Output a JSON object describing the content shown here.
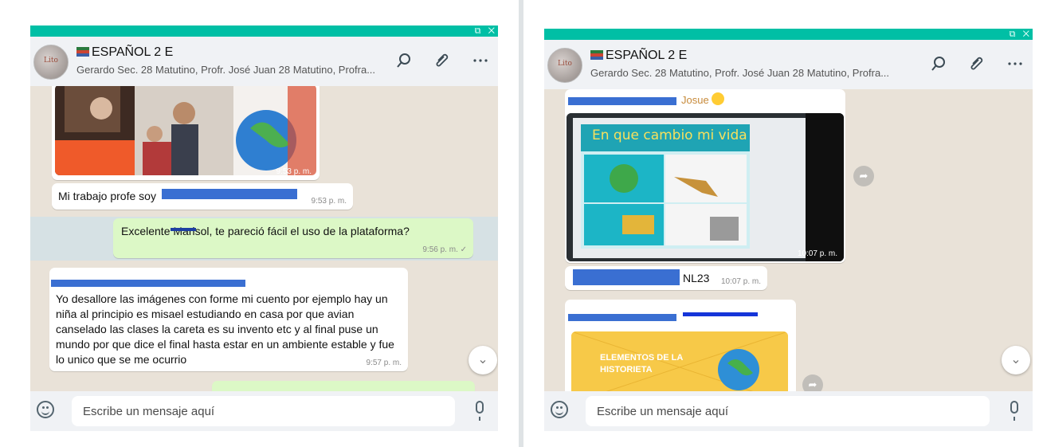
{
  "left": {
    "header": {
      "title": "ESPAÑOL 2 E",
      "subtitle": "Gerardo Sec. 28 Matutino, Profr. José Juan 28 Matutino, Profra..."
    },
    "image_message": {
      "time": "9:53 p. m."
    },
    "messages": [
      {
        "text": "Mi trabajo profe soy",
        "time": "9:53 p. m."
      },
      {
        "text": "Excelente Marisol, te pareció fácil el uso de la plataforma?",
        "time": "9:56 p. m. ✓"
      },
      {
        "text": "Yo desallore las imágenes con forme mi cuento por ejemplo hay un niña al principio  es misael estudiando en casa por que avian canselado las clases la careta es su invento etc y al final puse un mundo por que dice el final hasta estar en un ambiente estable y fue lo unico que se me ocurrio",
        "time": "9:57 p. m."
      }
    ],
    "compose_placeholder": "Escribe un mensaje aquí",
    "icons": [
      "search-icon",
      "attach-icon",
      "menu-icon",
      "emoji-icon",
      "mic-icon",
      "scroll-down-icon"
    ]
  },
  "right": {
    "header": {
      "title": "ESPAÑOL 2 E",
      "subtitle": "Gerardo Sec. 28 Matutino, Profr. José Juan 28 Matutino, Profra..."
    },
    "sender_name": "Josue",
    "image_message": {
      "poster_title": "En que cambio mi vida",
      "time": "10:07 p. m."
    },
    "caption": {
      "text": "NL23",
      "time": "10:07 p. m."
    },
    "card_text": {
      "line1": "ELEMENTOS DE LA",
      "line2": "HISTORIETA"
    },
    "compose_placeholder": "Escribe un mensaje aquí"
  },
  "colors": {
    "header_accent": "#00bfa5",
    "chat_bg": "#e9e2d8",
    "outgoing": "#dcf8c6",
    "redaction": "#3a6fd2"
  }
}
